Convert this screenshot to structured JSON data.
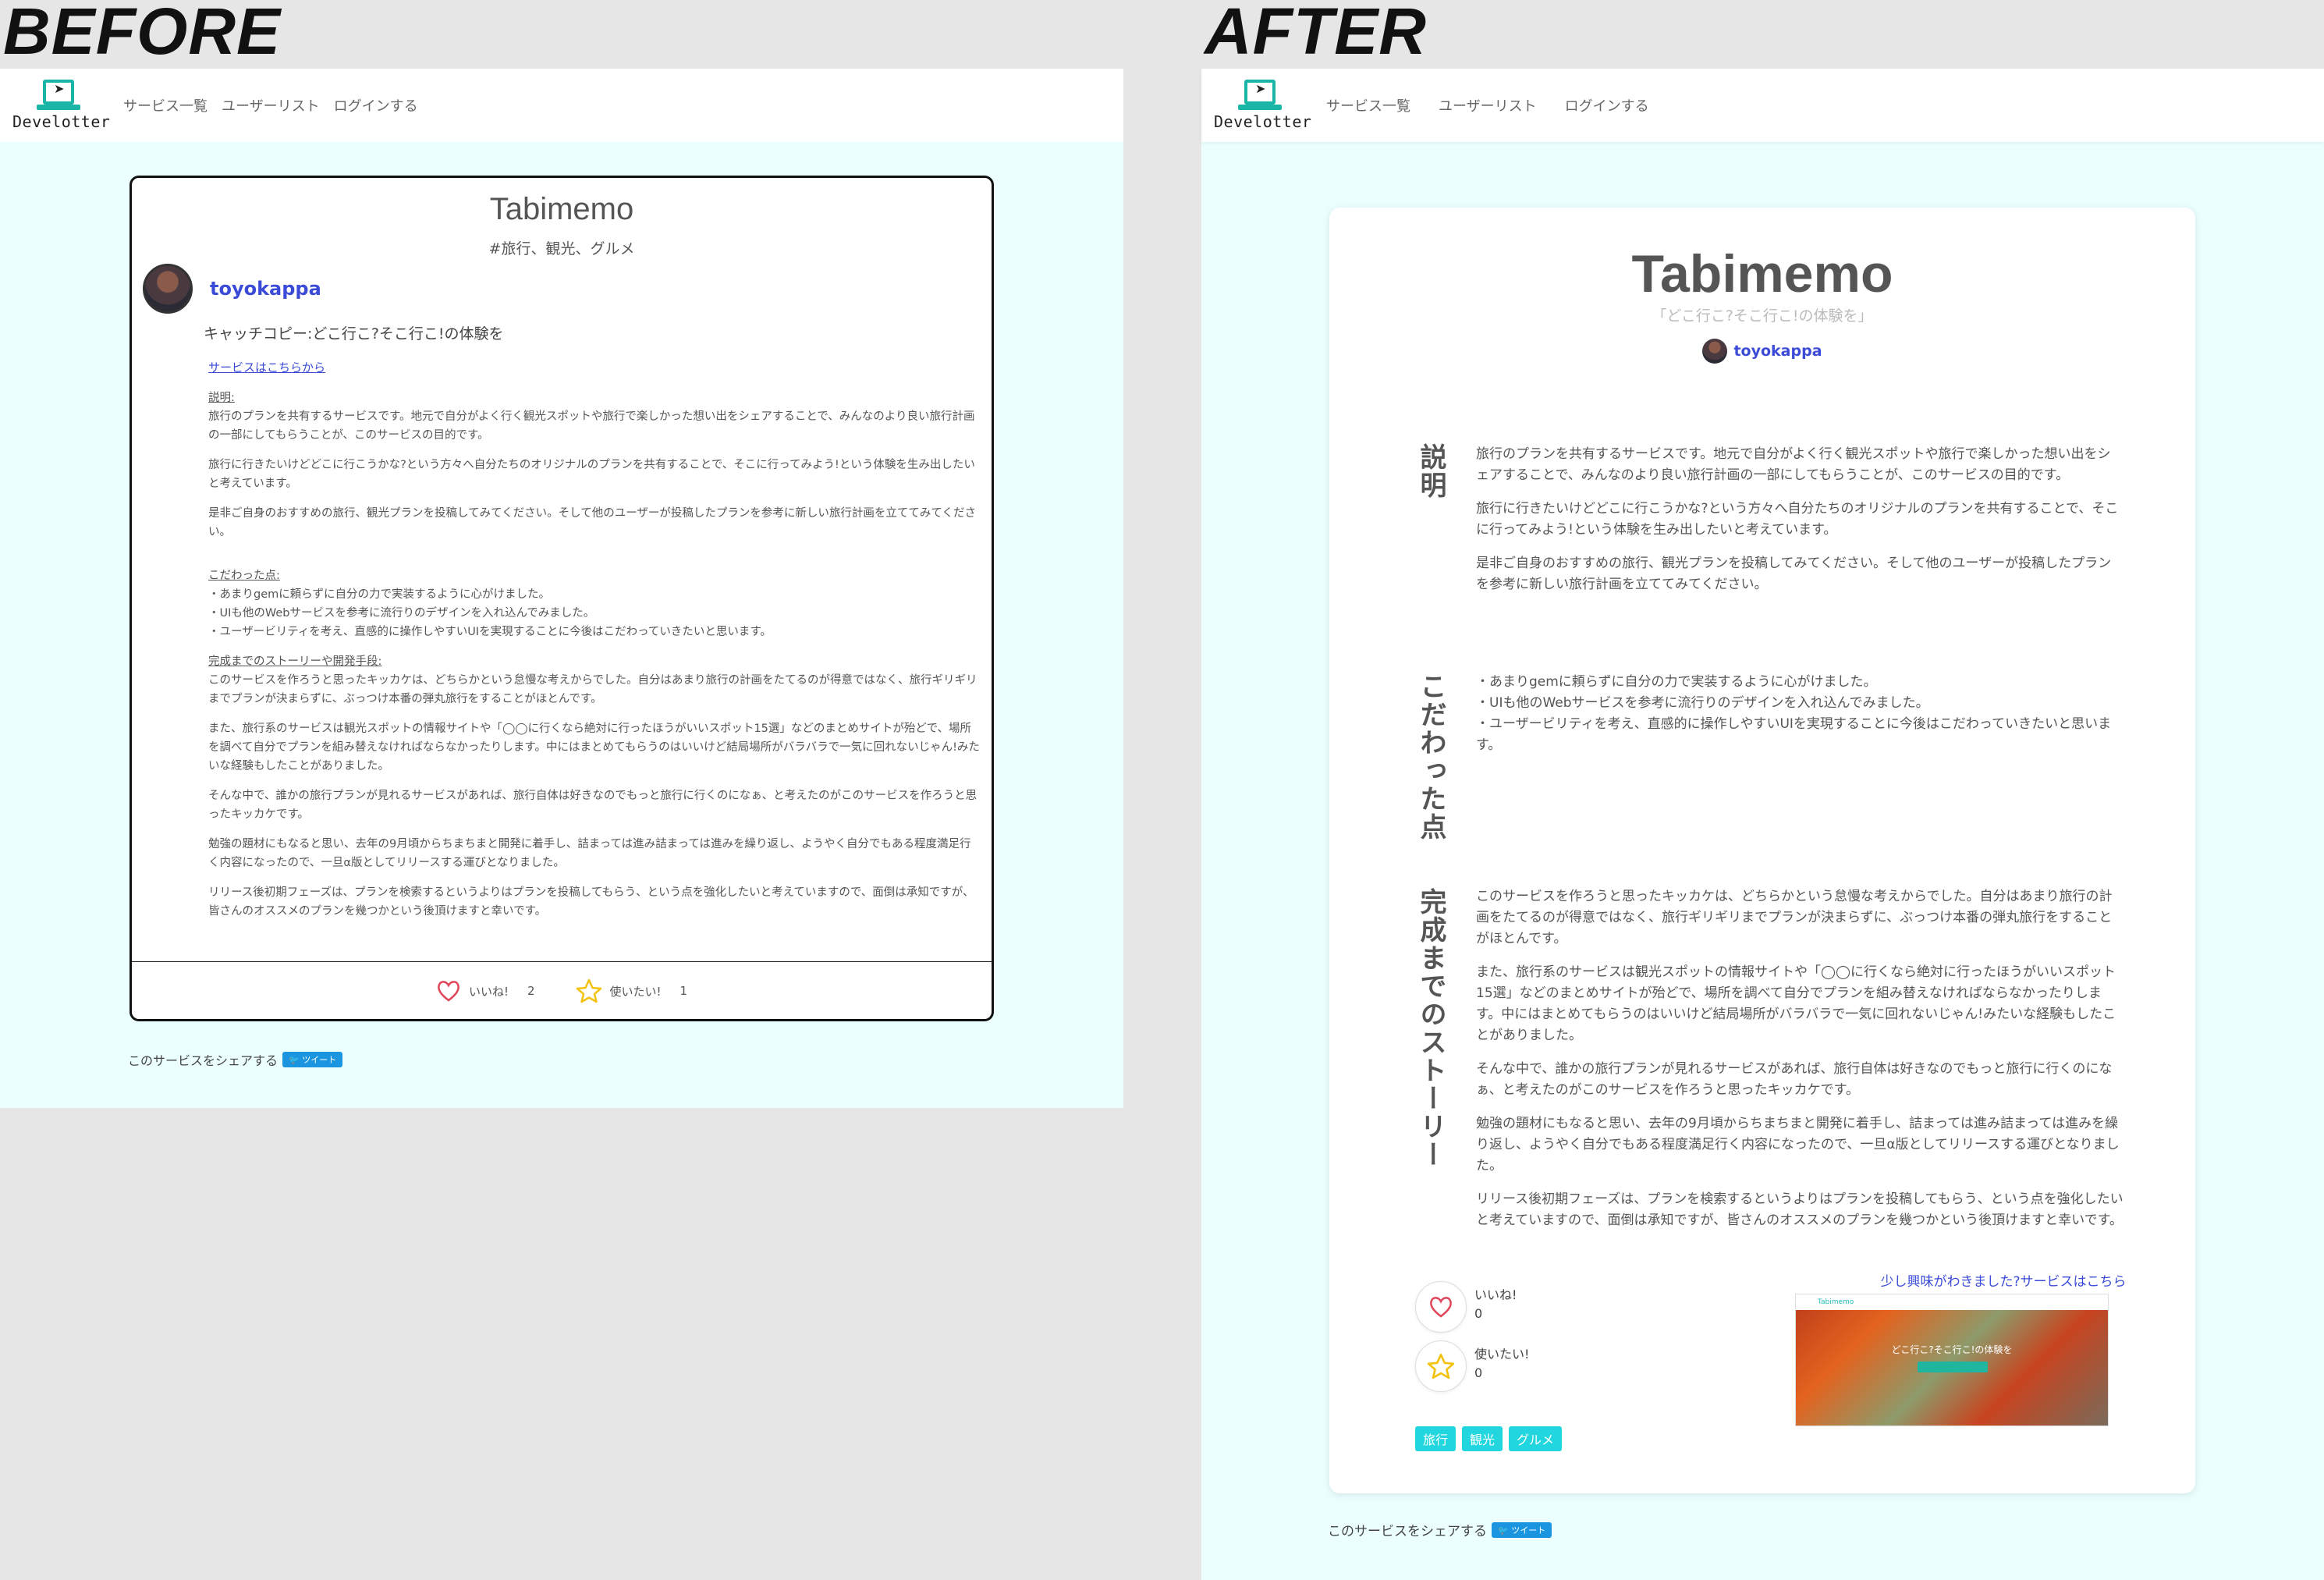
{
  "labels": {
    "before": "BEFORE",
    "after": "AFTER"
  },
  "brand": {
    "name": "Develotter",
    "accent": "#19b5a7"
  },
  "nav": {
    "items": [
      "サービス一覧",
      "ユーザーリスト",
      "ログインする"
    ]
  },
  "service": {
    "title": "Tabimemo",
    "tags_line": "#旅行、観光、グルメ",
    "user": "toyokappa",
    "catchcopy_label": "キャッチコピー:どこ行こ?そこ行こ!の体験を",
    "catchcopy_quoted": "「どこ行こ?そこ行こ!の体験を」",
    "service_link": "サービスはこちらから",
    "description_heading": "説明:",
    "description": [
      "旅行のプランを共有するサービスです。地元で自分がよく行く観光スポットや旅行で楽しかった想い出をシェアすることで、みんなのより良い旅行計画の一部にしてもらうことが、このサービスの目的です。",
      "旅行に行きたいけどどこに行こうかな?という方々へ自分たちのオリジナルのプランを共有することで、そこに行ってみよう!という体験を生み出したいと考えています。",
      "是非ご自身のおすすめの旅行、観光プランを投稿してみてください。そして他のユーザーが投稿したプランを参考に新しい旅行計画を立ててみてください。"
    ],
    "points_heading": "こだわった点:",
    "points": [
      "・あまりgemに頼らずに自分の力で実装するように心がけました。",
      "・UIも他のWebサービスを参考に流行りのデザインを入れ込んでみました。",
      "・ユーザービリティを考え、直感的に操作しやすいUIを実現することに今後はこだわっていきたいと思います。"
    ],
    "story_heading": "完成までのストーリーや開発手段:",
    "story": [
      "このサービスを作ろうと思ったキッカケは、どちらかという怠慢な考えからでした。自分はあまり旅行の計画をたてるのが得意ではなく、旅行ギリギリまでプランが決まらずに、ぶっつけ本番の弾丸旅行をすることがほとんです。",
      "また、旅行系のサービスは観光スポットの情報サイトや「◯◯に行くなら絶対に行ったほうがいいスポット15選」などのまとめサイトが殆どで、場所を調べて自分でプランを組み替えなければならなかったりします。中にはまとめてもらうのはいいけど結局場所がバラバラで一気に回れないじゃん!みたいな経験もしたことがありました。",
      "そんな中で、誰かの旅行プランが見れるサービスがあれば、旅行自体は好きなのでもっと旅行に行くのになぁ、と考えたのがこのサービスを作ろうと思ったキッカケです。",
      "勉強の題材にもなると思い、去年の9月頃からちまちまと開発に着手し、詰まっては進み詰まっては進みを繰り返し、ようやく自分でもある程度満足行く内容になったので、一旦α版としてリリースする運びとなりました。",
      "リリース後初期フェーズは、プランを検索するというよりはプランを投稿してもらう、という点を強化したいと考えていますので、面倒は承知ですが、皆さんのオススメのプランを幾つかという後頂けますと幸いです。"
    ],
    "like_label": "いいね!",
    "want_label": "使いたい!",
    "before_like_count": "2",
    "before_want_count": "1",
    "after_like_count": "0",
    "after_want_count": "0",
    "vertical_headings": [
      "説明",
      "こだわった点",
      "完成までのストーリー"
    ],
    "tag_list": [
      "旅行",
      "観光",
      "グルメ"
    ],
    "after_service_link": "少し興味がわきました?サービスはこちら",
    "screenshot": {
      "brand": "Tabimemo",
      "caption": "どこ行こ?そこ行こ!の体験を"
    }
  },
  "share": {
    "label": "このサービスをシェアする",
    "tweet": "ツイート"
  },
  "colors": {
    "page_bg": "#ebffff",
    "link": "#3b4bd8",
    "tag": "#22d6e0",
    "heart": "#e0455a",
    "star": "#f2c20f"
  }
}
